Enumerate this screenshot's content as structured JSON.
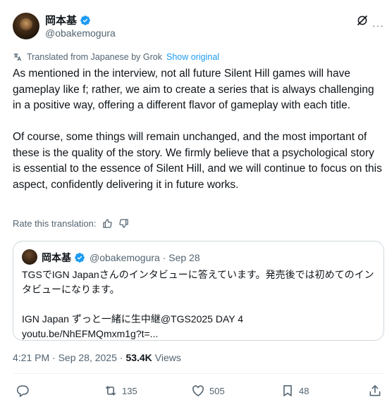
{
  "author": {
    "display_name": "岡本基",
    "handle": "@obakemogura"
  },
  "translation": {
    "notice": "Translated from Japanese by Grok",
    "show_original": "Show original"
  },
  "post": {
    "paragraph_1": " As mentioned in the interview, not all future Silent Hill games will have gameplay like f; rather, we aim to create a series that is always challenging in a positive way, offering a different flavor of gameplay with each title.",
    "paragraph_2": "Of course, some things will remain unchanged, and the most important of these is the quality of the story. We firmly believe that a psychological story is essential to the essence of Silent Hill, and we will continue to focus on this aspect, confidently delivering it in future works."
  },
  "rate_translation": {
    "label": "Rate this translation:"
  },
  "quoted_post": {
    "display_name": "岡本基",
    "handle_date": "@obakemogura · Sep 28",
    "line_1": "TGSでIGN Japanさんのインタビューに答えています。発売後では初めてのインタビューになります。",
    "line_2": "IGN Japan ずっと一緒に生中継@TGS2025 DAY 4",
    "line_3": "youtu.be/NhEFMQmxm1g?t=..."
  },
  "meta": {
    "timestamp": "4:21 PM · Sep 28, 2025 · ",
    "views_count": "53.4K",
    "views_label": "Views"
  },
  "actions": {
    "reposts": "135",
    "likes": "505",
    "bookmarks": "48"
  },
  "colors": {
    "accent": "#1d9bf0",
    "secondary_text": "#536471",
    "border": "#cfd9de"
  },
  "icons": [
    "verified-badge-icon",
    "grok-icon",
    "translate-icon",
    "thumbs-up-icon",
    "thumbs-down-icon",
    "reply-icon",
    "repost-icon",
    "like-icon",
    "bookmark-icon",
    "share-icon"
  ]
}
